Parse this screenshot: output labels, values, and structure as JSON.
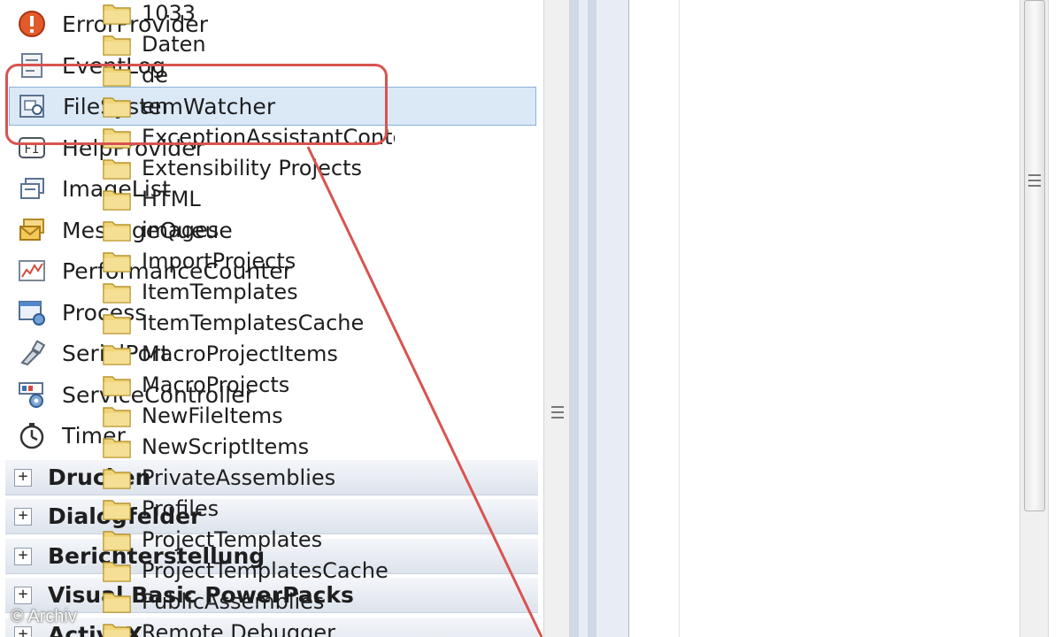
{
  "toolbox": {
    "items": [
      {
        "label": "ErrorProvider",
        "icon": "error-provider-icon"
      },
      {
        "label": "EventLog",
        "icon": "event-log-icon"
      },
      {
        "label": "FileSystemWatcher",
        "icon": "file-system-watcher-icon",
        "selected": true
      },
      {
        "label": "HelpProvider",
        "icon": "help-provider-icon"
      },
      {
        "label": "ImageList",
        "icon": "image-list-icon"
      },
      {
        "label": "MessageQueue",
        "icon": "message-queue-icon"
      },
      {
        "label": "PerformanceCounter",
        "icon": "performance-counter-icon"
      },
      {
        "label": "Process",
        "icon": "process-icon"
      },
      {
        "label": "SerialPort",
        "icon": "serial-port-icon"
      },
      {
        "label": "ServiceController",
        "icon": "service-controller-icon"
      },
      {
        "label": "Timer",
        "icon": "timer-icon"
      }
    ],
    "categories": [
      {
        "label": "Drucken",
        "toggle": "+"
      },
      {
        "label": "Dialogfelder",
        "toggle": "+"
      },
      {
        "label": "Berichterstellung",
        "toggle": "+"
      },
      {
        "label": "Visual Basic PowerPacks",
        "toggle": "+"
      },
      {
        "label": "ActiveX",
        "toggle": "+"
      }
    ]
  },
  "folders": [
    "1033",
    "Daten",
    "de",
    "en",
    "ExceptionAssistantContent",
    "Extensibility Projects",
    "HTML",
    "images",
    "ImportProjects",
    "ItemTemplates",
    "ItemTemplatesCache",
    "MacroProjectItems",
    "MacroProjects",
    "NewFileItems",
    "NewScriptItems",
    "PrivateAssemblies",
    "Profiles",
    "ProjectTemplates",
    "ProjectTemplatesCache",
    "PublicAssemblies",
    "Remote Debugger"
  ],
  "watermark": "© Archiv",
  "colors": {
    "highlight": "#d9534f",
    "selection": "#dbe9f7",
    "folder": "#f2d77a"
  }
}
